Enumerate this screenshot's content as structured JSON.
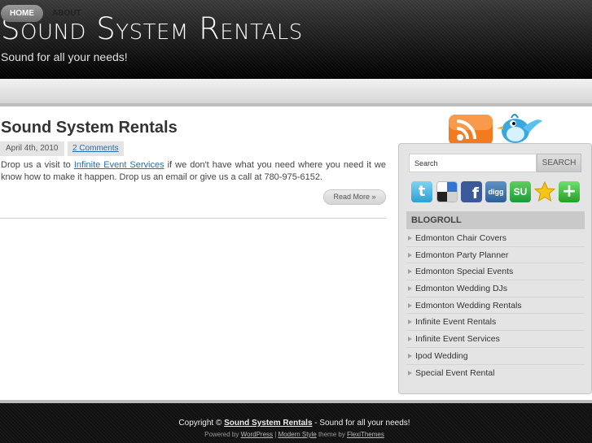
{
  "header": {
    "title": "Sound System Rentals",
    "tagline": "Sound for all your needs!"
  },
  "nav": {
    "home": "HOME",
    "about": "ABOUT"
  },
  "post": {
    "title": "Sound System Rentals",
    "date": "April 4th, 2010",
    "comments": "2 Comments",
    "body_before": "Drop us a visit to ",
    "body_link": "Infinite Event Services",
    "body_after": " if we don't have what you need where you need it we know how to make it happen.  Drop us an email or give us a call at 780-975-6152.",
    "read_more": "Read More »"
  },
  "sidebar": {
    "search_value": "Search",
    "search_button": "SEARCH",
    "social_icons": [
      "twitter-icon",
      "delicious-icon",
      "facebook-icon",
      "digg-icon",
      "stumbleupon-icon",
      "favorite-star-icon",
      "add-plus-icon"
    ],
    "digg_label": "digg",
    "stumble_label": "SU",
    "facebook_label": "f",
    "twitter_label": "t",
    "plus_label": "+",
    "blogroll_heading": "BLOGROLL",
    "blogroll": [
      "Edmonton Chair Covers",
      "Edmonton Party Planner",
      "Edmonton Special Events",
      "Edmonton Wedding DJs",
      "Edmonton Wedding Rentals",
      "Infinite Event Rentals",
      "Infinite Event Services",
      "Ipod Wedding",
      "Special Event Rental"
    ]
  },
  "footer": {
    "copyright": "Copyright ©",
    "site_link": "Sound System Rentals",
    "tagline": " - Sound for all your needs!",
    "powered_by": "Powered by",
    "wordpress": "WordPress",
    "sep": "|",
    "modern_style": "Modern Style",
    "theme_by": "theme by",
    "flexithemes": "FlexiThemes"
  },
  "colors": {
    "link": "#2a6ea6",
    "header_bg": "#111111",
    "nav_active": "#7a7a7a",
    "rss_orange": "#f47a20",
    "twitter_blue": "#3ba7dd"
  }
}
